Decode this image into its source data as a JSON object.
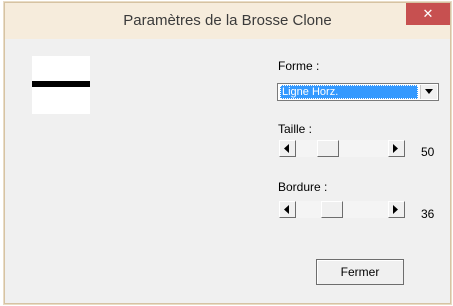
{
  "window": {
    "title": "Paramètres de la Brosse Clone",
    "close_symbol": "✕"
  },
  "preview": {
    "shape_icon": "horizontal-line"
  },
  "shape": {
    "label": "Forme :",
    "selected": "Ligne Horz."
  },
  "size": {
    "label": "Taille :",
    "value": "50"
  },
  "border": {
    "label": "Bordure :",
    "value": "36"
  },
  "buttons": {
    "close_label": "Fermer"
  }
}
